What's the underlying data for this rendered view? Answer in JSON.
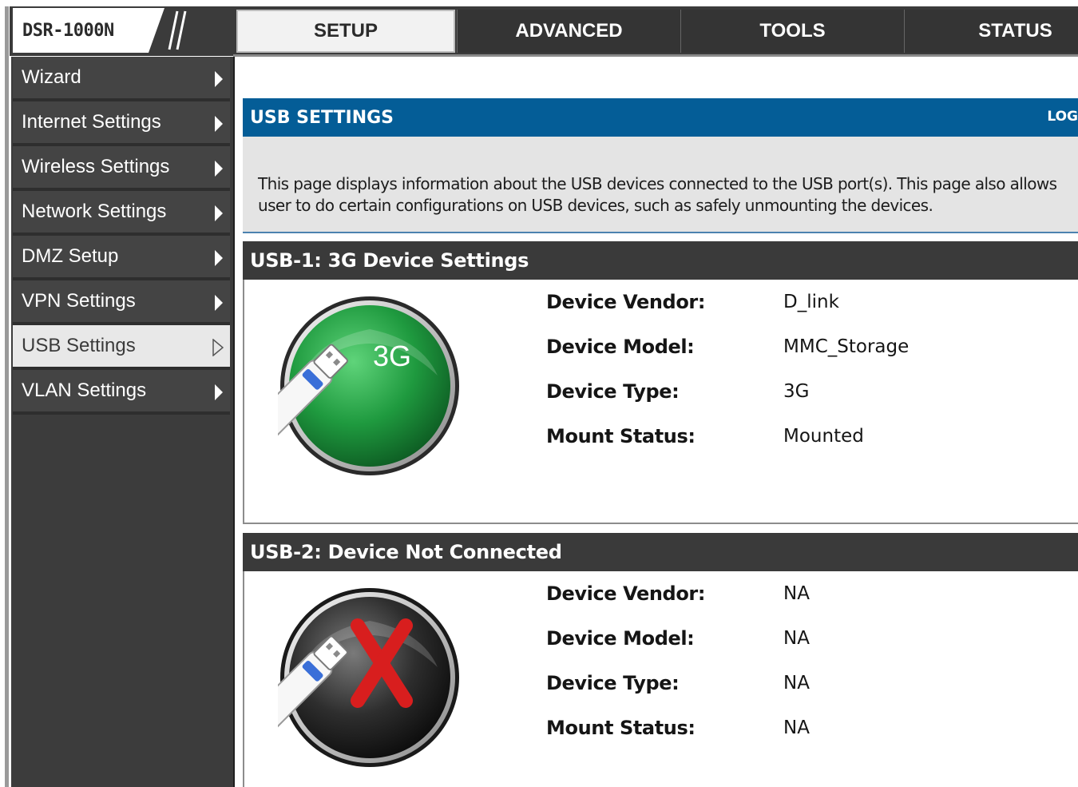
{
  "brand": {
    "model": "DSR-1000N"
  },
  "tabs": [
    {
      "label": "SETUP",
      "active": true
    },
    {
      "label": "ADVANCED",
      "active": false
    },
    {
      "label": "TOOLS",
      "active": false
    },
    {
      "label": "STATUS",
      "active": false
    }
  ],
  "sidebar": {
    "items": [
      {
        "label": "Wizard",
        "active": false
      },
      {
        "label": "Internet Settings",
        "active": false
      },
      {
        "label": "Wireless Settings",
        "active": false
      },
      {
        "label": "Network Settings",
        "active": false
      },
      {
        "label": "DMZ Setup",
        "active": false
      },
      {
        "label": "VPN Settings",
        "active": false
      },
      {
        "label": "USB Settings",
        "active": true
      },
      {
        "label": "VLAN Settings",
        "active": false
      }
    ]
  },
  "page": {
    "title": "USB SETTINGS",
    "logout": "LOG",
    "description": "This page displays information about the USB devices connected to the USB port(s). This page also allows user to do certain configurations on USB devices, such as safely unmounting the devices."
  },
  "usb1": {
    "title": "USB-1: 3G Device Settings",
    "badge": "3G",
    "icon": "usb-3g-connected-icon",
    "fields": [
      {
        "label": "Device Vendor:",
        "value": "D_link"
      },
      {
        "label": "Device Model:",
        "value": "MMC_Storage"
      },
      {
        "label": "Device Type:",
        "value": "3G"
      },
      {
        "label": "Mount Status:",
        "value": "Mounted"
      }
    ]
  },
  "usb2": {
    "title": "USB-2: Device Not Connected",
    "icon": "usb-not-connected-icon",
    "fields": [
      {
        "label": "Device Vendor:",
        "value": "NA"
      },
      {
        "label": "Device Model:",
        "value": "NA"
      },
      {
        "label": "Device Type:",
        "value": "NA"
      },
      {
        "label": "Mount Status:",
        "value": "NA"
      }
    ]
  },
  "colors": {
    "header_blue": "#045d97",
    "dark_gray": "#3a3a3a",
    "connected_green": "#1f9a3f",
    "error_red": "#d81e1e"
  }
}
